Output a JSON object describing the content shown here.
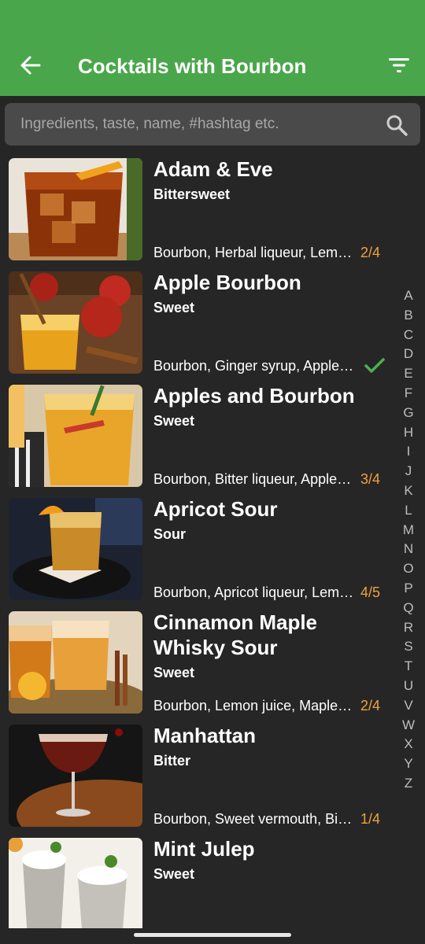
{
  "header": {
    "title": "Cocktails with Bourbon"
  },
  "search": {
    "placeholder": "Ingredients, taste, name, #hashtag etc."
  },
  "colors": {
    "appbar": "#4aa64a",
    "count": "#f0a23a",
    "check": "#4caf50",
    "background": "#262626"
  },
  "cocktails": [
    {
      "name": "Adam & Eve",
      "taste": "Bittersweet",
      "ingredients": "Bourbon, Herbal liqueur, Lemon juice",
      "count": "2/4"
    },
    {
      "name": "Apple Bourbon",
      "taste": "Sweet",
      "ingredients": "Bourbon, Ginger syrup, Apple juice",
      "count": "",
      "status_icon": "check-icon"
    },
    {
      "name": "Apples and Bourbon",
      "taste": "Sweet",
      "ingredients": "Bourbon, Bitter liqueur, Apple juice",
      "count": "3/4"
    },
    {
      "name": "Apricot Sour",
      "taste": "Sour",
      "ingredients": "Bourbon, Apricot liqueur, Lemon juice",
      "count": "4/5"
    },
    {
      "name": "Cinnamon Maple Whisky Sour",
      "taste": "Sweet",
      "ingredients": "Bourbon, Lemon juice, Maple syrup",
      "count": "2/4"
    },
    {
      "name": "Manhattan",
      "taste": "Bitter",
      "ingredients": "Bourbon, Sweet vermouth, Bitters",
      "count": "1/4"
    },
    {
      "name": "Mint Julep",
      "taste": "Sweet",
      "ingredients": "",
      "count": ""
    }
  ],
  "alphabet": [
    "A",
    "B",
    "C",
    "D",
    "E",
    "F",
    "G",
    "H",
    "I",
    "J",
    "K",
    "L",
    "M",
    "N",
    "O",
    "P",
    "Q",
    "R",
    "S",
    "T",
    "U",
    "V",
    "W",
    "X",
    "Y",
    "Z"
  ]
}
